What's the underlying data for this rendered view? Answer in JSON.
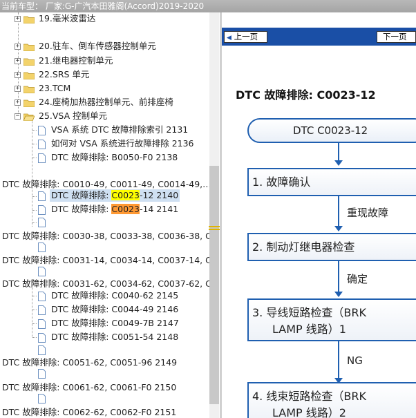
{
  "titlebar": {
    "text": "当前车型：  厂家:G-广汽本田雅阁(Accord)2019-2020"
  },
  "tree": {
    "items": [
      {
        "label": "19.毫米波雷达"
      },
      {
        "label": "20.驻车、倒车传感器控制单元"
      },
      {
        "label": "21.继电器控制单元"
      },
      {
        "label": "22.SRS 单元"
      },
      {
        "label": "23.TCM"
      },
      {
        "label": "24.座椅加热器控制单元、前排座椅"
      },
      {
        "label": "25.VSA 控制单元"
      },
      {
        "label": "VSA 系统 DTC 故障排除索引 2131"
      },
      {
        "label": "如何对 VSA 系统进行故障排除 2136"
      },
      {
        "label": "DTC 故障排除: B0050-F0 2138"
      },
      {
        "label": "DTC 故障排除: C0010-49, C0011-49, C0014-49,…"
      },
      {
        "label_pre": "DTC 故障排除: ",
        "label_hl": "C0023",
        "label_post": "-12 2140"
      },
      {
        "label_pre": "DTC 故障排除: ",
        "label_hl": "C0023",
        "label_post": "-14 2141"
      },
      {
        "label": "DTC 故障排除: C0030-38, C0033-38, C0036-38, C"
      },
      {
        "label": "DTC 故障排除: C0031-14, C0034-14, C0037-14, C"
      },
      {
        "label": "DTC 故障排除: C0031-62, C0034-62, C0037-62, C"
      },
      {
        "label": "DTC 故障排除: C0040-62 2145"
      },
      {
        "label": "DTC 故障排除: C0044-49 2146"
      },
      {
        "label": "DTC 故障排除: C0049-7B 2147"
      },
      {
        "label": "DTC 故障排除: C0051-54 2148"
      },
      {
        "label": "DTC 故障排除: C0051-62, C0051-96 2149"
      },
      {
        "label": "DTC 故障排除: C0061-62, C0061-F0 2150"
      },
      {
        "label": "DTC 故障排除: C0062-62, C0062-F0 2151"
      }
    ],
    "expander_plus": "+",
    "expander_minus": "−"
  },
  "nav": {
    "prev_label": "上一页",
    "next_label": "下一页"
  },
  "flow": {
    "heading": "DTC 故障排除: C0023-12",
    "start": "DTC C0023-12",
    "steps": [
      {
        "line1": "1.  故障确认"
      },
      {
        "line1": "2.  制动灯继电器检查"
      },
      {
        "line1": "3.  导线短路检查（BRK",
        "line2": "LAMP 线路）1"
      },
      {
        "line1": "4.  线束短路检查（BRK",
        "line2": "LAMP 线路）2"
      }
    ],
    "edges": [
      "重现故障",
      "确定",
      "NG"
    ]
  },
  "colors": {
    "nav_bar": "#1a4fa6",
    "flow_border": "#1f5fb0",
    "highlight_yellow": "#ffff00",
    "highlight_orange": "#ff9933"
  }
}
